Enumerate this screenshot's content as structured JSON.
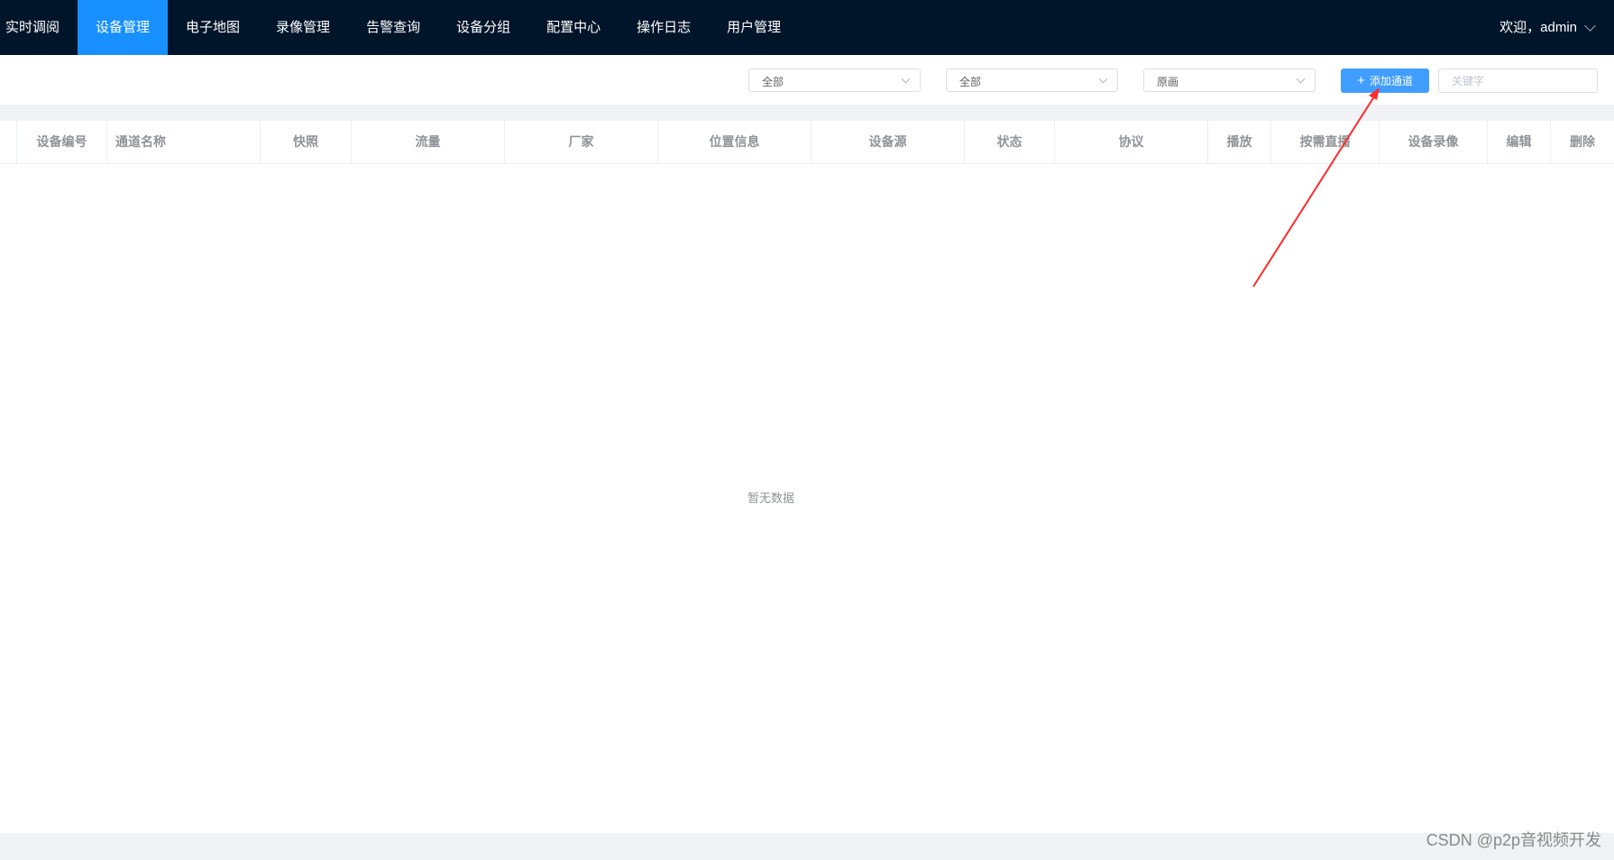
{
  "nav": {
    "items": [
      "实时调阅",
      "设备管理",
      "电子地图",
      "录像管理",
      "告警查询",
      "设备分组",
      "配置中心",
      "操作日志",
      "用户管理"
    ],
    "active_index": 1,
    "welcome": "欢迎，admin"
  },
  "toolbar": {
    "filter1": "全部",
    "filter2": "全部",
    "filter3": "原画",
    "add_button": "添加通道",
    "search_placeholder": "关键字"
  },
  "table": {
    "columns": [
      "设备编号",
      "通道名称",
      "快照",
      "流量",
      "厂家",
      "位置信息",
      "设备源",
      "状态",
      "协议",
      "播放",
      "按需直播",
      "设备录像",
      "编辑",
      "删除"
    ],
    "empty_text": "暂无数据"
  },
  "annotation": {
    "color": "#ff2a2a"
  },
  "watermark": "CSDN @p2p音视频开发"
}
